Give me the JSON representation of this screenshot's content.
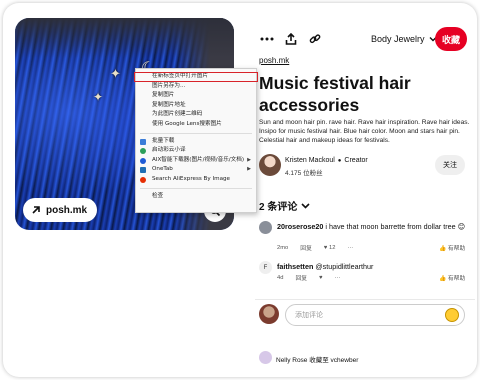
{
  "image": {
    "source_label": "posh.mk"
  },
  "context_menu": {
    "items": [
      {
        "label": "在新标签页中打开图片",
        "highlighted": true,
        "icon": "none"
      },
      {
        "label": "图片另存为...",
        "icon": "none"
      },
      {
        "label": "复制图片",
        "icon": "none"
      },
      {
        "label": "复制图片地址",
        "icon": "none"
      },
      {
        "label": "为此图片创建二维码",
        "icon": "none"
      },
      {
        "label": "使用 Google Lens搜索图片",
        "icon": "none"
      }
    ],
    "extension_items": [
      {
        "label": "批量下载",
        "icon": "download-extension-icon",
        "color": "#3b7dd8"
      },
      {
        "label": "启动彩云小译",
        "icon": "caiyun-icon",
        "color": "#2c9f5a"
      },
      {
        "label": "AIX智能下载器(图片/视频/音乐/文档)",
        "icon": "aix-downloader-icon",
        "color": "#1e5bd6",
        "submenu": true
      },
      {
        "label": "OneTab",
        "icon": "onetab-icon",
        "color": "#1f6fb5",
        "submenu": true
      },
      {
        "label": "Search AliExpress By Image",
        "icon": "aliexpress-icon",
        "color": "#e62e04"
      }
    ],
    "inspect_label": "检查"
  },
  "toolbar": {
    "more_icon": "ellipsis-icon",
    "share_icon": "share-icon",
    "link_icon": "link-icon",
    "board_name": "Body Jewelry",
    "save_label": "收藏"
  },
  "pin": {
    "domain": "posh.mk",
    "title": "Music festival hair accessories",
    "description": "Sun and moon hair pin. rave hair. Rave hair inspiration. Rave hair ideas. Insipo for music festival hair. Blue hair color. Moon and stars hair pin. Celestial hair and makeup ideas for festivals.",
    "creator": {
      "name": "Kristen Mackoul",
      "badge": "Creator",
      "followers": "4.175 位粉丝",
      "follow_label": "关注"
    }
  },
  "comments": {
    "heading": "2 条评论",
    "items": [
      {
        "user": "20roserose20",
        "text": "i have that moon barrette from dollar tree",
        "emoji": "😊",
        "age": "2mo",
        "reply_label": "回复",
        "likes": "12",
        "help_label": "有帮助",
        "avatar_color": "#8a8f99"
      },
      {
        "user": "faithsetten",
        "text": "@stupidlittlearthur",
        "age": "4d",
        "reply_label": "回复",
        "help_label": "有帮助",
        "avatar_letter": "F",
        "avatar_color": "#efefef"
      }
    ]
  },
  "comment_box": {
    "placeholder": "添加评论"
  },
  "saved_by": {
    "text": "Nelly Rose 收藏至 vchewber"
  },
  "colors": {
    "accent": "#e60023",
    "highlight_border": "#d8232a"
  }
}
